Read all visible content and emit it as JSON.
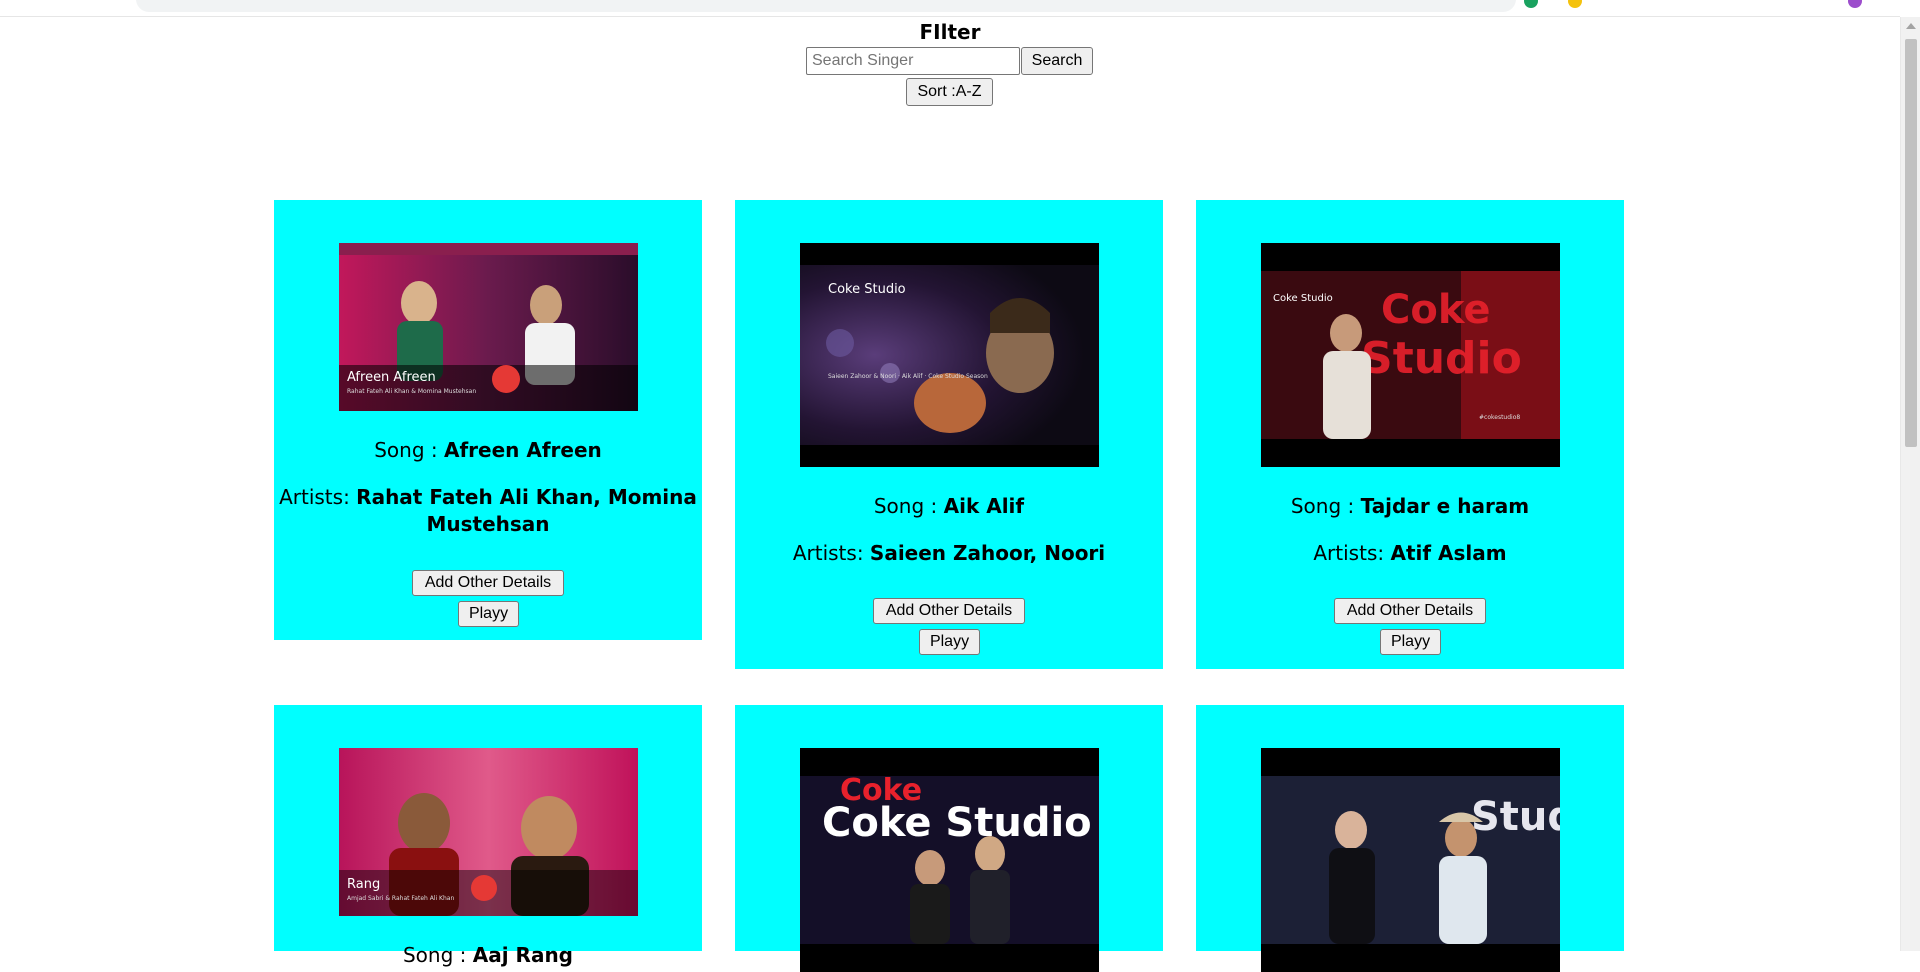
{
  "filter": {
    "title": "FIlter",
    "search_placeholder": "Search Singer",
    "search_value": "",
    "search_label": "Search",
    "sort_label": "Sort :A-Z"
  },
  "labels": {
    "song_prefix": "Song : ",
    "artists_prefix": "Artists: ",
    "add_details": "Add Other Details",
    "play": "Playy"
  },
  "cards": [
    {
      "song": "Afreen Afreen",
      "artists_line1": "Rahat Fateh Ali Khan, Momina",
      "artists_line2": "Mustehsan",
      "thumb_caption": "Afreen Afreen",
      "thumb_subcaption": "Rahat Fateh Ali Khan & Momina Mustehsan"
    },
    {
      "song": "Aik Alif",
      "artists_line1": "Saieen Zahoor, Noori",
      "artists_line2": "",
      "thumb_caption": "Coke Studio",
      "thumb_subcaption": "Saieen Zahoor & Noori · Aik Alif · Coke Studio Season"
    },
    {
      "song": "Tajdar e haram",
      "artists_line1": "Atif Aslam",
      "artists_line2": "",
      "thumb_caption": "Coke Studio",
      "thumb_subcaption": "#cokestudio8"
    },
    {
      "song": "Aaj Rang",
      "artists_line1": "",
      "artists_line2": "",
      "thumb_caption": "Rang",
      "thumb_subcaption": "Amjad Sabri & Rahat Fateh Ali Khan"
    },
    {
      "song": "",
      "artists_line1": "",
      "artists_line2": "",
      "thumb_caption": "Coke Studio",
      "thumb_subcaption": ""
    },
    {
      "song": "",
      "artists_line1": "",
      "artists_line2": "",
      "thumb_caption": "Studio",
      "thumb_subcaption": ""
    }
  ],
  "colors": {
    "card_bg": "#00ffff",
    "button_bg": "#efefef"
  }
}
